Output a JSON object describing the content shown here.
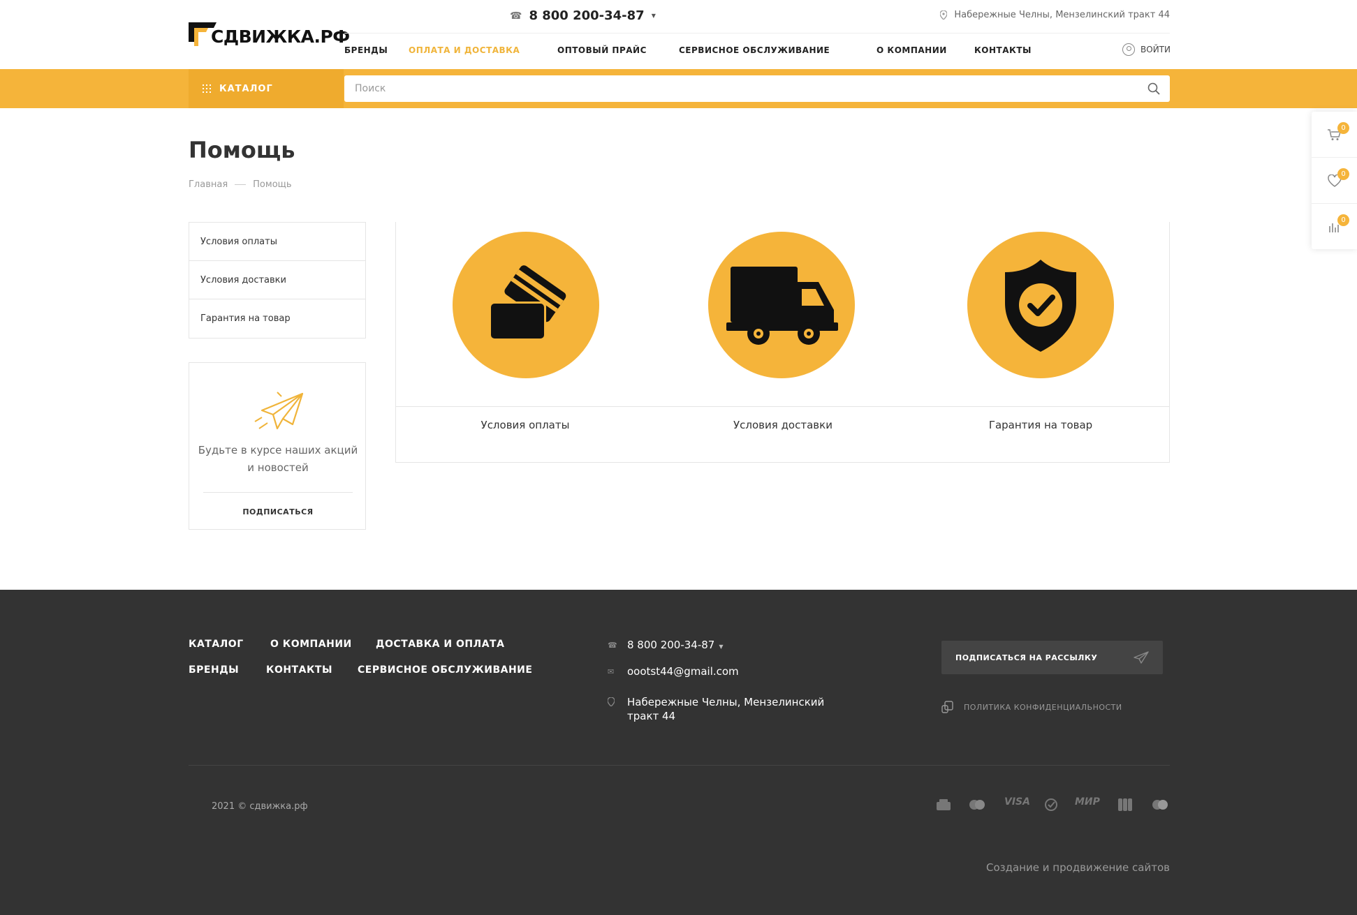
{
  "brand": {
    "logo_text": "СДВИЖКА.РФ"
  },
  "header": {
    "phone": "8 800 200-34-87",
    "address": "Набережные Челны, Мензелинский тракт 44",
    "login": "ВОЙТИ",
    "nav": [
      {
        "label": "БРЕНДЫ",
        "active": false
      },
      {
        "label": "ОПЛАТА И ДОСТАВКА",
        "active": true
      },
      {
        "label": "ОПТОВЫЙ ПРАЙС",
        "active": false
      },
      {
        "label": "СЕРВИСНОЕ ОБСЛУЖИВАНИЕ",
        "active": false
      },
      {
        "label": "О КОМПАНИИ",
        "active": false
      },
      {
        "label": "КОНТАКТЫ",
        "active": false
      }
    ]
  },
  "catbar": {
    "catalog": "КАТАЛОГ",
    "search_placeholder": "Поиск"
  },
  "float_panel": {
    "cart_count": "0",
    "favorites_count": "0",
    "compare_count": "0"
  },
  "page": {
    "title": "Помощь",
    "breadcrumb": [
      "Главная",
      "Помощь"
    ]
  },
  "side_menu": [
    "Условия оплаты",
    "Условия доставки",
    "Гарантия на товар"
  ],
  "subscribe": {
    "text": "Будьте в курсе наших акций и новостей",
    "button": "ПОДПИСАТЬСЯ"
  },
  "cards": [
    {
      "label": "Условия оплаты",
      "icon": "credit-cards-icon"
    },
    {
      "label": "Условия доставки",
      "icon": "truck-icon"
    },
    {
      "label": "Гарантия на товар",
      "icon": "shield-check-icon"
    }
  ],
  "footer": {
    "nav_row1": [
      "КАТАЛОГ",
      "О КОМПАНИИ",
      "ДОСТАВКА И ОПЛАТА"
    ],
    "nav_row2": [
      "БРЕНДЫ",
      "КОНТАКТЫ",
      "СЕРВИСНОЕ ОБСЛУЖИВАНИЕ"
    ],
    "phone": "8 800 200-34-87",
    "email": "oootst44@gmail.com",
    "address_line1": "Набережные Челны, Мензелинский",
    "address_line2": "тракт 44",
    "subscribe": "ПОДПИСАТЬСЯ НА РАССЫЛКУ",
    "privacy": "ПОЛИТИКА КОНФИДЕНЦИАЛЬНОСТИ",
    "copyright": "2021 © сдвижка.рф",
    "payments": [
      "VISA",
      "МИР"
    ],
    "creator": "Создание и продвижение сайтов"
  },
  "colors": {
    "accent": "#f5b43a",
    "footer_bg": "#333333"
  }
}
